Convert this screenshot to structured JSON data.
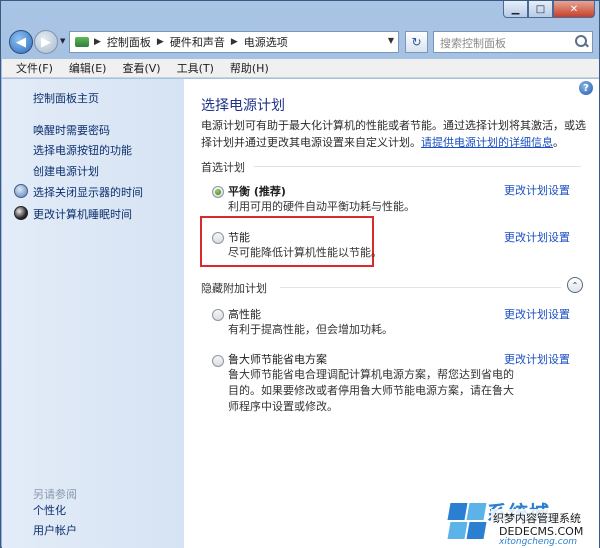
{
  "window": {
    "min_label": "▁",
    "max_label": "□",
    "close_label": "✕"
  },
  "address": {
    "back_label": "◀",
    "fwd_label": "▶",
    "dropdown_label": "▼",
    "breadcrumbs": [
      "控制面板",
      "硬件和声音",
      "电源选项"
    ],
    "separator": "▶",
    "refresh_label": "↻",
    "search_placeholder": "搜索控制面板"
  },
  "menu": [
    "文件(F)",
    "编辑(E)",
    "查看(V)",
    "工具(T)",
    "帮助(H)"
  ],
  "sidebar": {
    "home": "控制面板主页",
    "links": [
      "唤醒时需要密码",
      "选择电源按钮的功能",
      "创建电源计划",
      "选择关闭显示器的时间",
      "更改计算机睡眠时间"
    ],
    "see_also_label": "另请参阅",
    "see_also": [
      "个性化",
      "用户帐户"
    ]
  },
  "main": {
    "help_label": "?",
    "title": "选择电源计划",
    "description": "电源计划可有助于最大化计算机的性能或者节能。通过选择计划将其激活，或选择计划并通过更改其电源设置来自定义计划。",
    "description_link": "请提供电源计划的详细信息",
    "preferred_header": "首选计划",
    "hidden_header": "隐藏附加计划",
    "collapse_label": "⌃",
    "change_link": "更改计划设置",
    "plans": [
      {
        "name": "平衡 (推荐)",
        "desc": "利用可用的硬件自动平衡功耗与性能。",
        "selected": true
      },
      {
        "name": "节能",
        "desc": "尽可能降低计算机性能以节能。",
        "selected": false
      },
      {
        "name": "高性能",
        "desc": "有利于提高性能，但会增加功耗。",
        "selected": false
      },
      {
        "name": "鲁大师节能省电方案",
        "desc": "鲁大师节能省电合理调配计算机电源方案，帮您达到省电的目的。如果要修改或者停用鲁大师节能电源方案，请在鲁大师程序中设置或修改。",
        "selected": false
      }
    ]
  },
  "watermark": {
    "brand": "系统城",
    "overlay_line1": "织梦内容管理系统",
    "overlay_line2": "DEDECMS.COM",
    "url": "xitongcheng.com"
  },
  "colors": {
    "link": "#1a4fc2",
    "title": "#1e3287",
    "highlight_box": "#d92b2b"
  }
}
